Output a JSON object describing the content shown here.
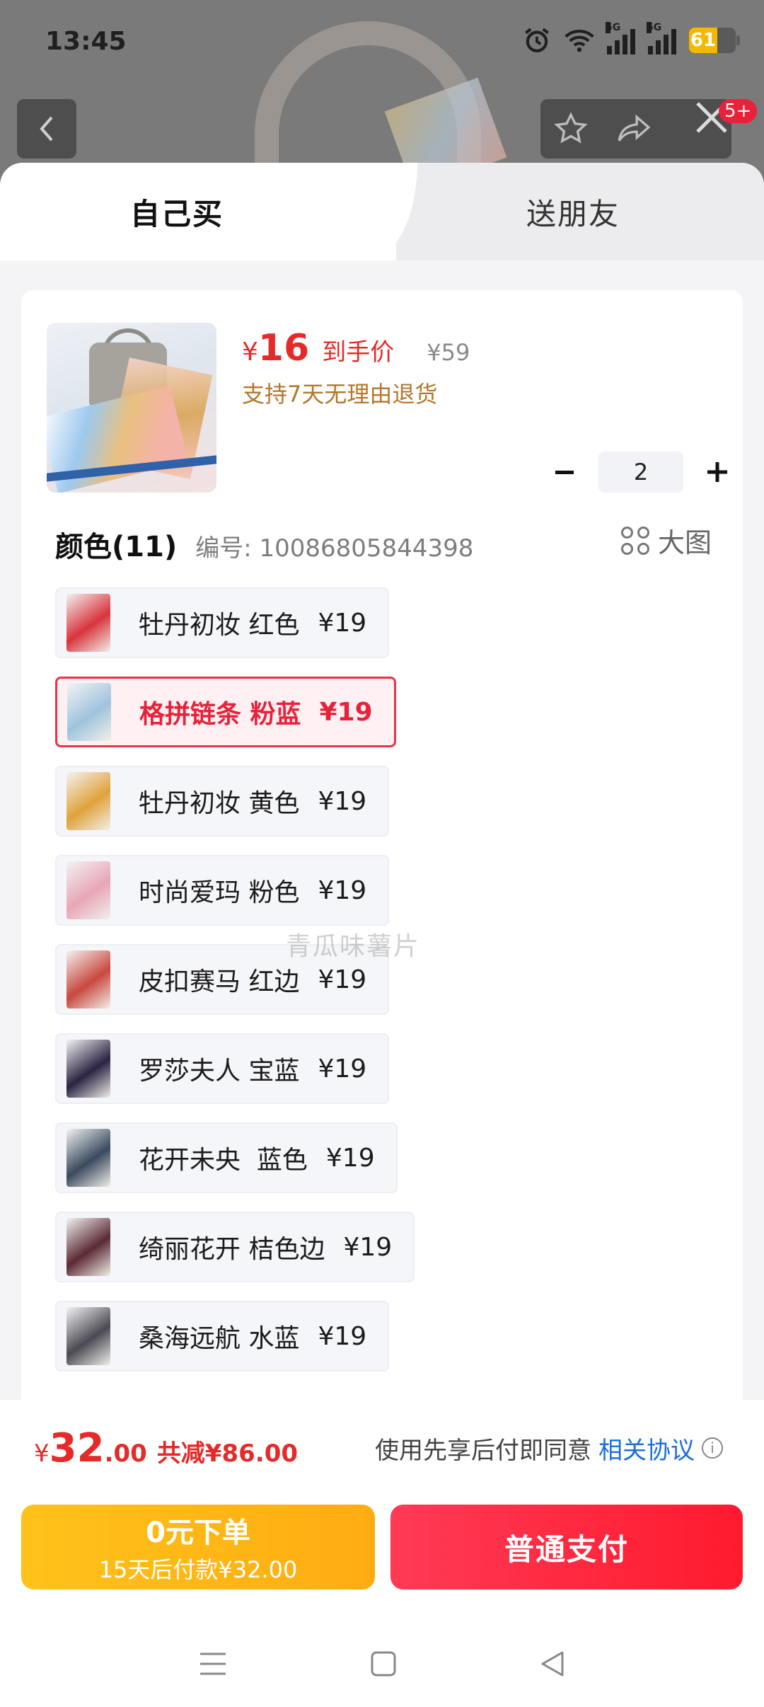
{
  "status_bar": {
    "time": "13:45",
    "battery": "61",
    "net1": "5G",
    "net2": "5G"
  },
  "background": {
    "notification_badge": "5+"
  },
  "tabs": {
    "self_buy": "自己买",
    "send_friend": "送朋友"
  },
  "product": {
    "price_symbol": "¥",
    "price": "16",
    "price_tag": "到手价",
    "original_price": "¥59",
    "return_policy": "支持7天无理由退货",
    "quantity": "2"
  },
  "colors": {
    "title": "颜色(11)",
    "code": "编号: 10086805844398",
    "big_view": "大图",
    "options": [
      {
        "label": "牡丹初妆 红色",
        "price": "¥19",
        "selected": false,
        "swatch": "#d8343b"
      },
      {
        "label": "格拼链条 粉蓝",
        "price": "¥19",
        "selected": true,
        "swatch": "#9fc3dd"
      },
      {
        "label": "牡丹初妆 黄色",
        "price": "¥19",
        "selected": false,
        "swatch": "#e0a23a"
      },
      {
        "label": "时尚爱玛 粉色",
        "price": "¥19",
        "selected": false,
        "swatch": "#e8a6b6"
      },
      {
        "label": "皮扣赛马 红边",
        "price": "¥19",
        "selected": false,
        "swatch": "#c9483e"
      },
      {
        "label": "罗莎夫人 宝蓝",
        "price": "¥19",
        "selected": false,
        "swatch": "#2b2342"
      },
      {
        "label": "花开未央  蓝色",
        "price": "¥19",
        "selected": false,
        "swatch": "#3a4a5e"
      },
      {
        "label": "绮丽花开 桔色边",
        "price": "¥19",
        "selected": false,
        "swatch": "#5c2a34"
      },
      {
        "label": "桑海远航 水蓝",
        "price": "¥19",
        "selected": false,
        "swatch": "#4b4a54"
      }
    ],
    "watermark": "青瓜味薯片"
  },
  "summary": {
    "symbol": "¥",
    "total_int": "32",
    "total_dec": ".00",
    "saving": "共减¥86.00",
    "agreement_text": "使用先享后付即同意",
    "agreement_link": "相关协议"
  },
  "actions": {
    "pay_later_title": "0元下单",
    "pay_later_sub": "15天后付款¥32.00",
    "pay_now": "普通支付"
  },
  "colors_theme": {
    "accent": "#e8223a",
    "gold": "#b4772a",
    "link": "#1a6fd8"
  }
}
